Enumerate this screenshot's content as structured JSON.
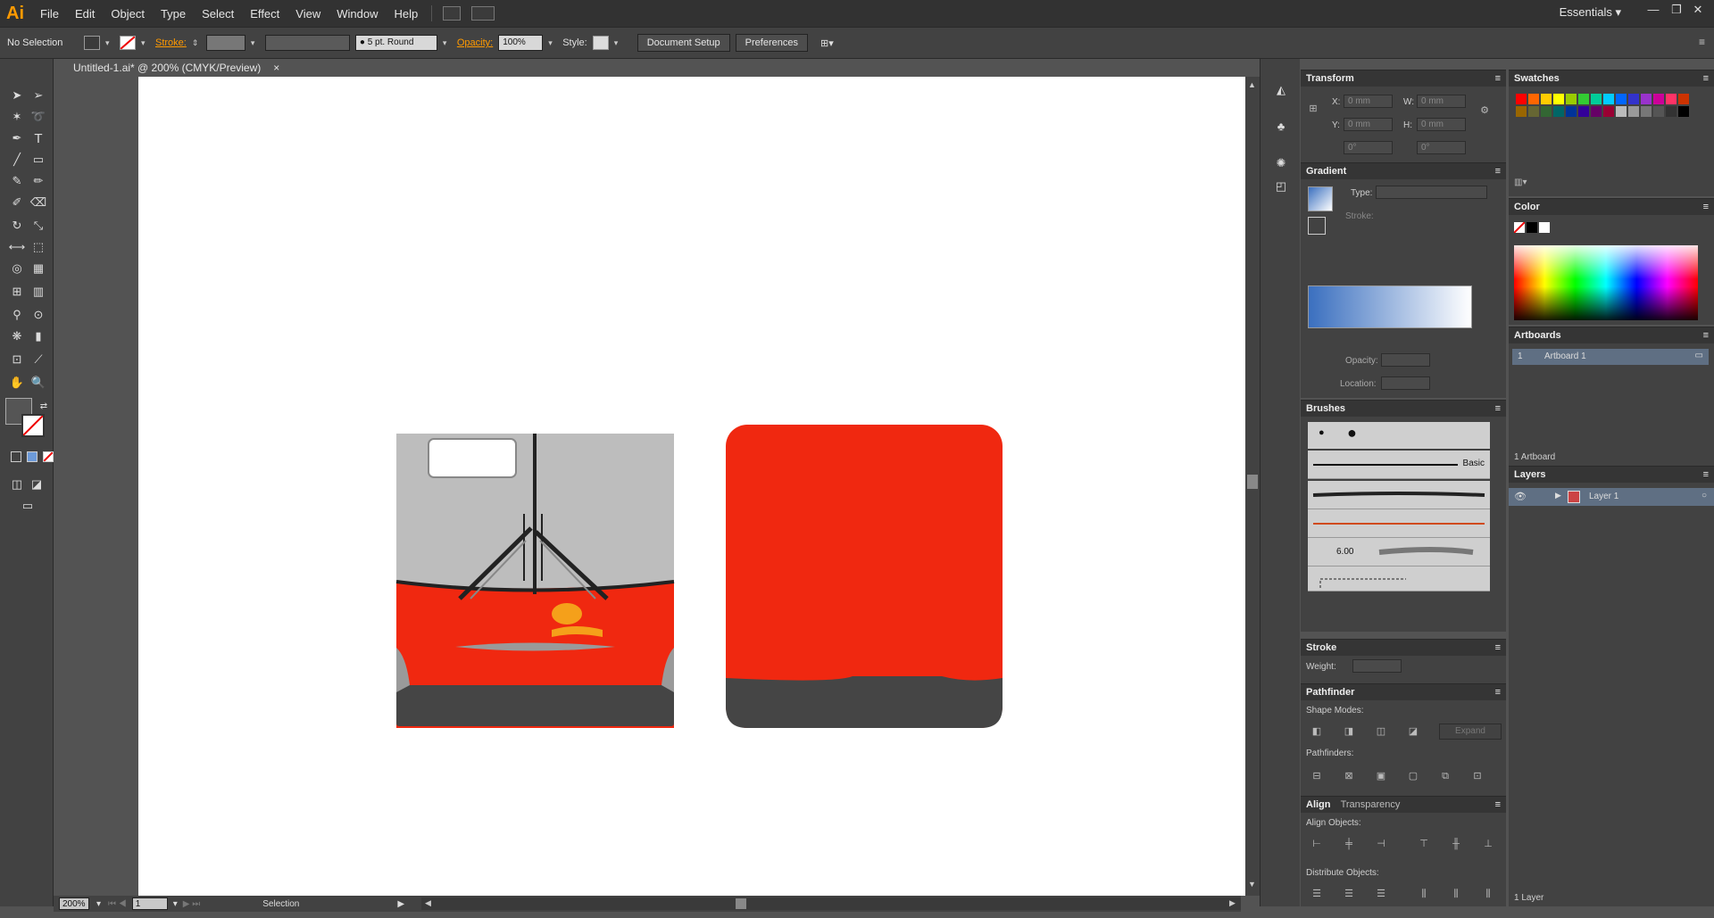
{
  "app": {
    "logo": "Ai",
    "workspace": "Essentials",
    "workspace_arrow": "▾"
  },
  "menu": [
    "File",
    "Edit",
    "Object",
    "Type",
    "Select",
    "Effect",
    "View",
    "Window",
    "Help"
  ],
  "window_controls": {
    "minimize": "—",
    "restore": "❐",
    "close": "✕"
  },
  "control_bar": {
    "selection": "No Selection",
    "stroke_label": "Stroke:",
    "brush": "5 pt. Round",
    "opacity_label": "Opacity:",
    "opacity": "100%",
    "style_label": "Style:",
    "document_setup": "Document Setup",
    "preferences": "Preferences"
  },
  "document": {
    "tab_title": "Untitled-1.ai* @ 200% (CMYK/Preview)",
    "close": "×"
  },
  "status": {
    "zoom": "200%",
    "page": "1",
    "tool": "Selection"
  },
  "transform": {
    "title": "Transform",
    "x_label": "X:",
    "x": "0 mm",
    "y_label": "Y:",
    "y": "0 mm",
    "w_label": "W:",
    "w": "0 mm",
    "h_label": "H:",
    "h": "0 mm",
    "rotate": "0°",
    "shear": "0°"
  },
  "gradient": {
    "title": "Gradient",
    "type_label": "Type:",
    "stroke_label": "Stroke:",
    "opacity_label": "Opacity:",
    "location_label": "Location:"
  },
  "brushes": {
    "title": "Brushes",
    "basic": "Basic",
    "size": "6.00"
  },
  "stroke": {
    "title": "Stroke",
    "weight_label": "Weight:"
  },
  "pathfinder": {
    "title": "Pathfinder",
    "shape_modes": "Shape Modes:",
    "pathfinders": "Pathfinders:",
    "expand": "Expand"
  },
  "align": {
    "title": "Align",
    "tab2": "Transparency",
    "align_objects": "Align Objects:",
    "distribute_objects": "Distribute Objects:"
  },
  "swatches": {
    "title": "Swatches"
  },
  "color": {
    "title": "Color"
  },
  "artboards": {
    "title": "Artboards",
    "rows": [
      {
        "num": "1",
        "name": "Artboard 1"
      }
    ],
    "count": "1 Artboard"
  },
  "layers": {
    "title": "Layers",
    "rows": [
      {
        "name": "Layer 1"
      }
    ],
    "count": "1 Layer"
  },
  "colors": {
    "accent": "#ff9a00",
    "bus_red": "#f02810",
    "bus_grey": "#bdbdbd",
    "bus_dark": "#404040"
  }
}
